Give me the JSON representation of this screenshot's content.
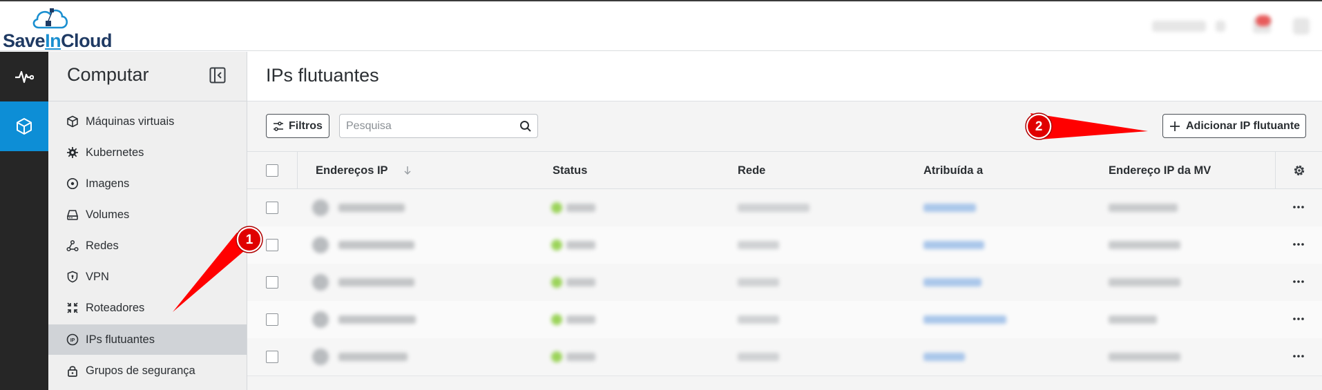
{
  "app": {
    "logo_text_prefix": "Save",
    "logo_text_in": "In",
    "logo_text_suffix": "Cloud",
    "accent_color": "#0d8ed6"
  },
  "rail": {
    "items": [
      {
        "icon": "activity-icon",
        "active": false
      },
      {
        "icon": "cube-icon",
        "active": true
      }
    ]
  },
  "sidebar": {
    "title": "Computar",
    "collapse_icon": "sidebar-collapse-icon",
    "items": [
      {
        "label": "Máquinas virtuais",
        "icon": "box-icon"
      },
      {
        "label": "Kubernetes",
        "icon": "helm-icon"
      },
      {
        "label": "Imagens",
        "icon": "disc-icon"
      },
      {
        "label": "Volumes",
        "icon": "drive-icon"
      },
      {
        "label": "Redes",
        "icon": "network-icon"
      },
      {
        "label": "VPN",
        "icon": "shield-icon"
      },
      {
        "label": "Roteadores",
        "icon": "router-icon"
      },
      {
        "label": "IPs flutuantes",
        "icon": "ip-icon",
        "active": true
      },
      {
        "label": "Grupos de segurança",
        "icon": "lock-icon"
      }
    ]
  },
  "main": {
    "title": "IPs flutuantes",
    "filter_label": "Filtros",
    "search_placeholder": "Pesquisa",
    "add_button_label": "Adicionar IP flutuante"
  },
  "table": {
    "columns": [
      "Endereços IP",
      "Status",
      "Rede",
      "Atribuída a",
      "Endereço IP da MV"
    ],
    "sort_icon": "arrow-down-icon",
    "settings_icon": "gear-icon",
    "row_count": 5
  },
  "annotations": {
    "callout_1": "1",
    "callout_2": "2",
    "arrow_color": "#ff0000"
  }
}
